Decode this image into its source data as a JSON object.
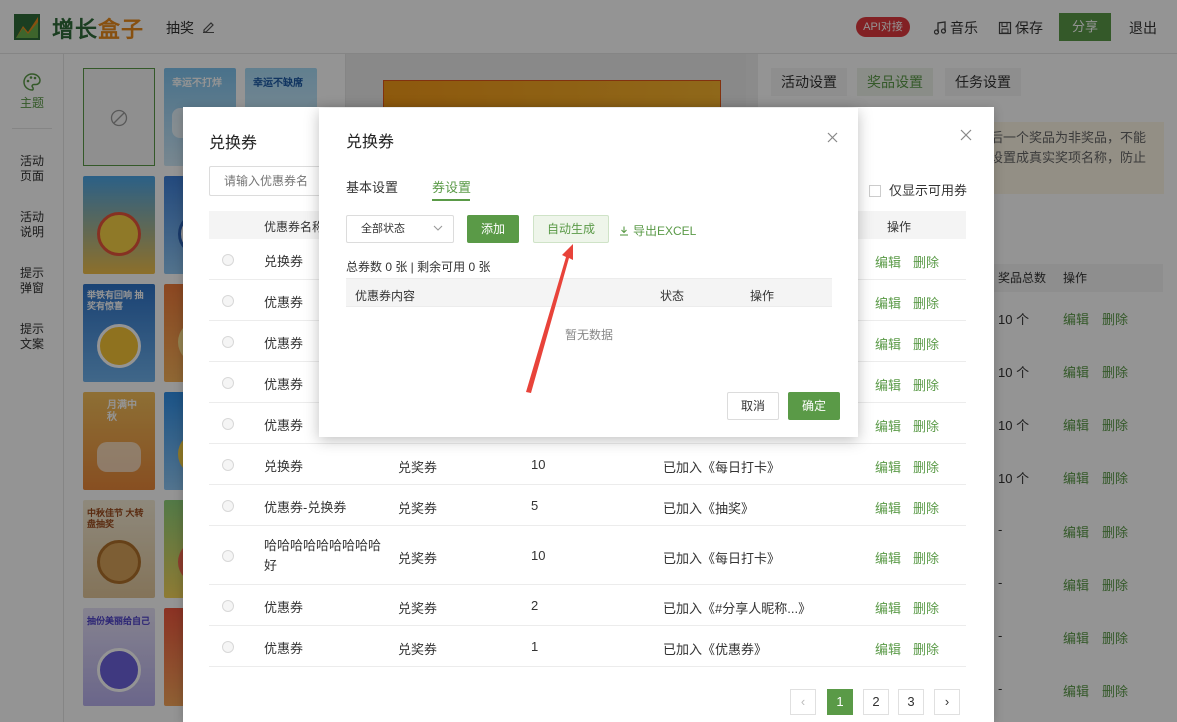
{
  "header": {
    "brand_main": "增长",
    "brand_accent": "盒子",
    "page_name": "抽奖",
    "api_badge": "API对接",
    "music": "音乐",
    "save": "保存",
    "share": "分享",
    "logout": "退出"
  },
  "leftnav": {
    "items": [
      {
        "label": "主题"
      },
      {
        "label": "活动\n页面"
      },
      {
        "label": "活动\n说明"
      },
      {
        "label": "提示\n弹窗"
      },
      {
        "label": "提示\n文案"
      }
    ]
  },
  "templates": [
    {
      "caption": "幸运不打烊"
    },
    {
      "caption": "幸运不缺席"
    },
    {
      "caption": "举铁有回响 抽奖有惊喜"
    },
    {
      "caption": "月满中秋"
    },
    {
      "caption": "中秋佳节 大转盘抽奖"
    },
    {
      "caption": "抽份美丽给自己"
    }
  ],
  "settings": {
    "tabs": [
      "活动设置",
      "奖品设置",
      "任务设置"
    ],
    "warning": "后一个奖品为非奖品，不能\n设置成真实奖项名称，防止",
    "table_head": [
      "奖品总数",
      "操作"
    ],
    "rows": [
      {
        "total": "10 个"
      },
      {
        "total": "10 个"
      },
      {
        "total": "10 个"
      },
      {
        "total": "10 个"
      },
      {
        "total": "-"
      },
      {
        "total": "-"
      },
      {
        "total": "-"
      },
      {
        "total": "-"
      }
    ],
    "edit": "编辑",
    "delete": "删除"
  },
  "picker": {
    "title": "兑换券",
    "search_placeholder": "请输入优惠券名",
    "only_available": "仅显示可用券",
    "columns": {
      "name": "优惠券名称",
      "ops": "操作"
    },
    "rows": [
      {
        "name": "兑换券",
        "type": "",
        "count": "",
        "status": ""
      },
      {
        "name": "优惠券",
        "type": "",
        "count": "",
        "status": ""
      },
      {
        "name": "优惠券",
        "type": "",
        "count": "",
        "status": ""
      },
      {
        "name": "优惠券",
        "type": "",
        "count": "",
        "status": ""
      },
      {
        "name": "优惠券",
        "type": "",
        "count": "",
        "status": ""
      },
      {
        "name": "兑换券",
        "type": "兑奖券",
        "count": "10",
        "status": "已加入《每日打卡》"
      },
      {
        "name": "优惠券-兑换券",
        "type": "兑奖券",
        "count": "5",
        "status": "已加入《抽奖》"
      },
      {
        "name": "哈哈哈哈哈哈哈哈哈\n好",
        "type": "兑奖券",
        "count": "10",
        "status": "已加入《每日打卡》"
      },
      {
        "name": "优惠券",
        "type": "兑奖券",
        "count": "2",
        "status": "已加入《#分享人昵称...》"
      },
      {
        "name": "优惠券",
        "type": "兑奖券",
        "count": "1",
        "status": "已加入《优惠券》"
      }
    ],
    "edit": "编辑",
    "delete": "删除",
    "pages": [
      "1",
      "2",
      "3"
    ]
  },
  "modal": {
    "title": "兑换券",
    "tabs": [
      "基本设置",
      "券设置"
    ],
    "status_select": "全部状态",
    "add": "添加",
    "auto_generate": "自动生成",
    "export": "导出EXCEL",
    "summary": "总券数 0 张 | 剩余可用 0 张",
    "columns": [
      "优惠券内容",
      "状态",
      "操作"
    ],
    "empty": "暂无数据",
    "cancel": "取消",
    "confirm": "确定"
  },
  "colors": {
    "brand_green": "#5a9a47",
    "brand_orange": "#e98b1c",
    "badge_red": "#e0393e",
    "annotation_arrow": "#e8433a"
  }
}
